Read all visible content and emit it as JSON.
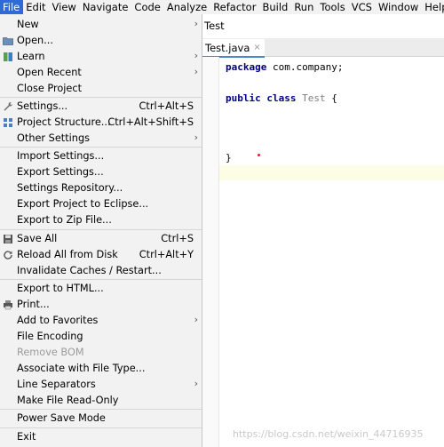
{
  "menubar": [
    {
      "label": "File",
      "active": true
    },
    {
      "label": "Edit"
    },
    {
      "label": "View"
    },
    {
      "label": "Navigate"
    },
    {
      "label": "Code"
    },
    {
      "label": "Analyze"
    },
    {
      "label": "Refactor"
    },
    {
      "label": "Build"
    },
    {
      "label": "Run"
    },
    {
      "label": "Tools"
    },
    {
      "label": "VCS"
    },
    {
      "label": "Window"
    },
    {
      "label": "Help"
    }
  ],
  "project_title": "Test",
  "editor": {
    "tab_label": "Test.java",
    "tab_close": "×",
    "code": {
      "line1_kw": "package",
      "line1_rest": " com.company;",
      "line2_kw1": "public",
      "line2_kw2": " class",
      "line2_cls": " Test",
      "line2_rest": " {",
      "line3": "}"
    }
  },
  "file_menu": {
    "items": [
      {
        "name": "new",
        "label": "New",
        "arrow": true
      },
      {
        "name": "open",
        "label": "Open...",
        "icon": "folder-icon"
      },
      {
        "name": "learn",
        "label": "Learn",
        "icon": "book-icon",
        "arrow": true
      },
      {
        "name": "open-recent",
        "label": "Open Recent",
        "arrow": true
      },
      {
        "name": "close-project",
        "label": "Close Project"
      },
      {
        "name": "settings",
        "label": "Settings...",
        "icon": "wrench-icon",
        "shortcut": "Ctrl+Alt+S"
      },
      {
        "name": "project-structure",
        "label": "Project Structure...",
        "icon": "project-structure-icon",
        "shortcut": "Ctrl+Alt+Shift+S"
      },
      {
        "name": "other-settings",
        "label": "Other Settings",
        "arrow": true
      },
      {
        "name": "import-settings",
        "label": "Import Settings..."
      },
      {
        "name": "export-settings",
        "label": "Export Settings..."
      },
      {
        "name": "settings-repository",
        "label": "Settings Repository..."
      },
      {
        "name": "export-to-eclipse",
        "label": "Export Project to Eclipse..."
      },
      {
        "name": "export-to-zip",
        "label": "Export to Zip File..."
      },
      {
        "name": "save-all",
        "label": "Save All",
        "icon": "save-icon",
        "shortcut": "Ctrl+S"
      },
      {
        "name": "reload-from-disk",
        "label": "Reload All from Disk",
        "icon": "reload-icon",
        "shortcut": "Ctrl+Alt+Y"
      },
      {
        "name": "invalidate-caches",
        "label": "Invalidate Caches / Restart..."
      },
      {
        "name": "export-to-html",
        "label": "Export to HTML..."
      },
      {
        "name": "print",
        "label": "Print...",
        "icon": "print-icon"
      },
      {
        "name": "add-to-favorites",
        "label": "Add to Favorites",
        "arrow": true
      },
      {
        "name": "file-encoding",
        "label": "File Encoding"
      },
      {
        "name": "remove-bom",
        "label": "Remove BOM",
        "disabled": true
      },
      {
        "name": "associate-file-type",
        "label": "Associate with File Type..."
      },
      {
        "name": "line-separators",
        "label": "Line Separators",
        "arrow": true
      },
      {
        "name": "make-read-only",
        "label": "Make File Read-Only"
      },
      {
        "name": "power-save-mode",
        "label": "Power Save Mode"
      },
      {
        "name": "exit",
        "label": "Exit"
      }
    ],
    "arrow_glyph": "›"
  },
  "watermark": "https://blog.csdn.net/weixin_44716935",
  "colors": {
    "menu_active": "#2e6ad8",
    "keyword": "#000080",
    "tab_underline": "#4a88c7"
  }
}
